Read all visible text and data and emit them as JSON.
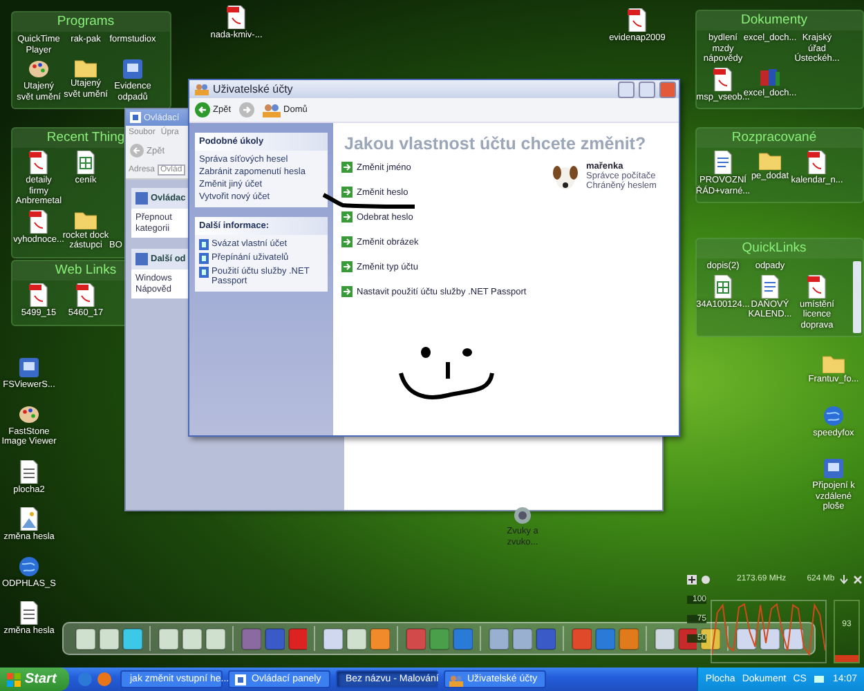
{
  "top_icons": [
    {
      "label": "nada-kmiv-...",
      "kind": "pdf"
    },
    {
      "label": "evidenap2009",
      "kind": "pdf"
    }
  ],
  "fences": [
    {
      "title": "Programs",
      "rows": [
        [
          {
            "label": "QuickTime Player",
            "kind": "text"
          },
          {
            "label": "rak-pak",
            "kind": "text"
          },
          {
            "label": "formstudiox",
            "kind": "text"
          }
        ],
        [
          {
            "label": "Utajený svět umění",
            "kind": "palette"
          },
          {
            "label": "Utajený svět umění",
            "kind": "folder"
          },
          {
            "label": "Evidence odpadů",
            "kind": "app"
          }
        ]
      ]
    },
    {
      "title": "Recent Thing",
      "rows": [
        [
          {
            "label": "detaily firmy Anbremetal",
            "kind": "pdf"
          },
          {
            "label": "ceník",
            "kind": "xls"
          }
        ],
        [
          {
            "label": "vyhodnoce...",
            "kind": "pdf"
          },
          {
            "label": "rocket dock zástupci",
            "kind": "folder"
          },
          {
            "label": "BO",
            "kind": "cut"
          }
        ]
      ]
    },
    {
      "title": "Web Links",
      "rows": [
        [
          {
            "label": "5499_15",
            "kind": "pdf"
          },
          {
            "label": "5460_17",
            "kind": "pdf"
          }
        ]
      ]
    },
    {
      "title": "Dokumenty",
      "rows": [
        [
          {
            "label": "bydlení mzdy nápovědy",
            "kind": "text"
          },
          {
            "label": "excel_doch...",
            "kind": "text"
          },
          {
            "label": "Krajský úřad Ústeckéh...",
            "kind": "text"
          }
        ],
        [
          {
            "label": "msp_vseob...",
            "kind": "pdf"
          },
          {
            "label": "excel_doch...",
            "kind": "books"
          }
        ]
      ]
    },
    {
      "title": "Rozpracované",
      "rows": [
        [
          {
            "label": "PROVOZNÍ ŘÁD+varné...",
            "kind": "doc"
          },
          {
            "label": "pe_dodat",
            "kind": "folder"
          },
          {
            "label": "kalendar_n...",
            "kind": "pdf"
          }
        ]
      ]
    },
    {
      "title": "QuickLinks",
      "scrollbar": true,
      "rows": [
        [
          {
            "label": "dopis(2)",
            "kind": "text"
          },
          {
            "label": "odpady",
            "kind": "text"
          }
        ],
        [
          {
            "label": "34A100124...",
            "kind": "xls"
          },
          {
            "label": "DAŇOVÝ KALEND...",
            "kind": "doc"
          },
          {
            "label": "umístění licence doprava",
            "kind": "pdf"
          }
        ]
      ]
    }
  ],
  "left_icons": [
    {
      "label": "FSViewerS...",
      "kind": "app"
    },
    {
      "label": "FastStone Image Viewer",
      "kind": "palette"
    },
    {
      "label": "plocha2",
      "kind": "txt"
    },
    {
      "label": "změna hesla",
      "kind": "image"
    },
    {
      "label": "ODPHLAS_S",
      "kind": "web"
    },
    {
      "label": "změna hesla",
      "kind": "txt"
    }
  ],
  "right_icons": [
    {
      "label": "Frantuv_fo...",
      "kind": "folder"
    },
    {
      "label": "speedyfox",
      "kind": "web"
    },
    {
      "label": "Připojení k vzdálené ploše",
      "kind": "app"
    }
  ],
  "control_panel_window": {
    "title": "Ovládací",
    "menu": [
      "Soubor",
      "Úpra"
    ],
    "back": "Zpět",
    "address_label": "Adresa",
    "address": "Ovlád",
    "panels": [
      {
        "title": "Ovládac",
        "links": [
          "Přepnout",
          "kategorii"
        ]
      },
      {
        "title": "Další od",
        "links": [
          "Windows",
          "Nápověd"
        ]
      }
    ],
    "items": [
      {
        "label": "Zvuky a zvuko..."
      }
    ]
  },
  "accounts_window": {
    "title": "Uživatelské účty",
    "back": "Zpět",
    "home": "Domů",
    "panels": [
      {
        "title": "Podobné úkoly",
        "kind": "tasks",
        "links": [
          "Správa síťových hesel",
          "Zabránit zapomenutí hesla",
          "Změnit jiný účet",
          "Vytvořit nový účet"
        ]
      },
      {
        "title": "Další informace:",
        "kind": "help",
        "links": [
          "Svázat vlastní účet",
          "Přepínání uživatelů",
          "Použití účtu služby .NET Passport"
        ]
      }
    ],
    "heading": "Jakou vlastnost účtu chcete změnit?",
    "options": [
      "Změnit jméno",
      "Změnit heslo",
      "Odebrat heslo",
      "Změnit obrázek",
      "Změnit typ účtu",
      "Nastavit použití účtu služby .NET Passport"
    ],
    "user": {
      "name": "mařenka",
      "lines": [
        "Správce počítače",
        "Chráněný heslem"
      ]
    }
  },
  "monitor": {
    "cpu": "2173.69 MHz",
    "memory": "624 Mb",
    "memory_percent": "93",
    "level": 0.12,
    "chart_data": {
      "type": "line",
      "ylim": [
        20,
        100
      ],
      "yticks": [
        50,
        75,
        100
      ],
      "series": [
        {
          "color": "#d04a1a",
          "values": [
            30,
            85,
            95,
            40,
            35,
            92,
            96,
            60,
            40,
            95,
            45,
            90,
            96,
            60,
            35,
            95,
            90,
            40,
            30,
            95,
            82,
            35
          ]
        }
      ]
    }
  },
  "taskbar": {
    "start": "Start",
    "tasks": [
      {
        "label": "jak změnit vstupní he...",
        "kind": "browser",
        "selected": false
      },
      {
        "label": "Ovládací panely",
        "kind": "panel",
        "selected": false
      },
      {
        "label": "Bez názvu - Malování",
        "kind": "paint",
        "selected": true
      },
      {
        "label": "Uživatelské účty",
        "kind": "users",
        "selected": false
      }
    ],
    "tray": [
      "Plocha",
      "Dokument"
    ],
    "language": "CS",
    "clock": "14:07"
  }
}
